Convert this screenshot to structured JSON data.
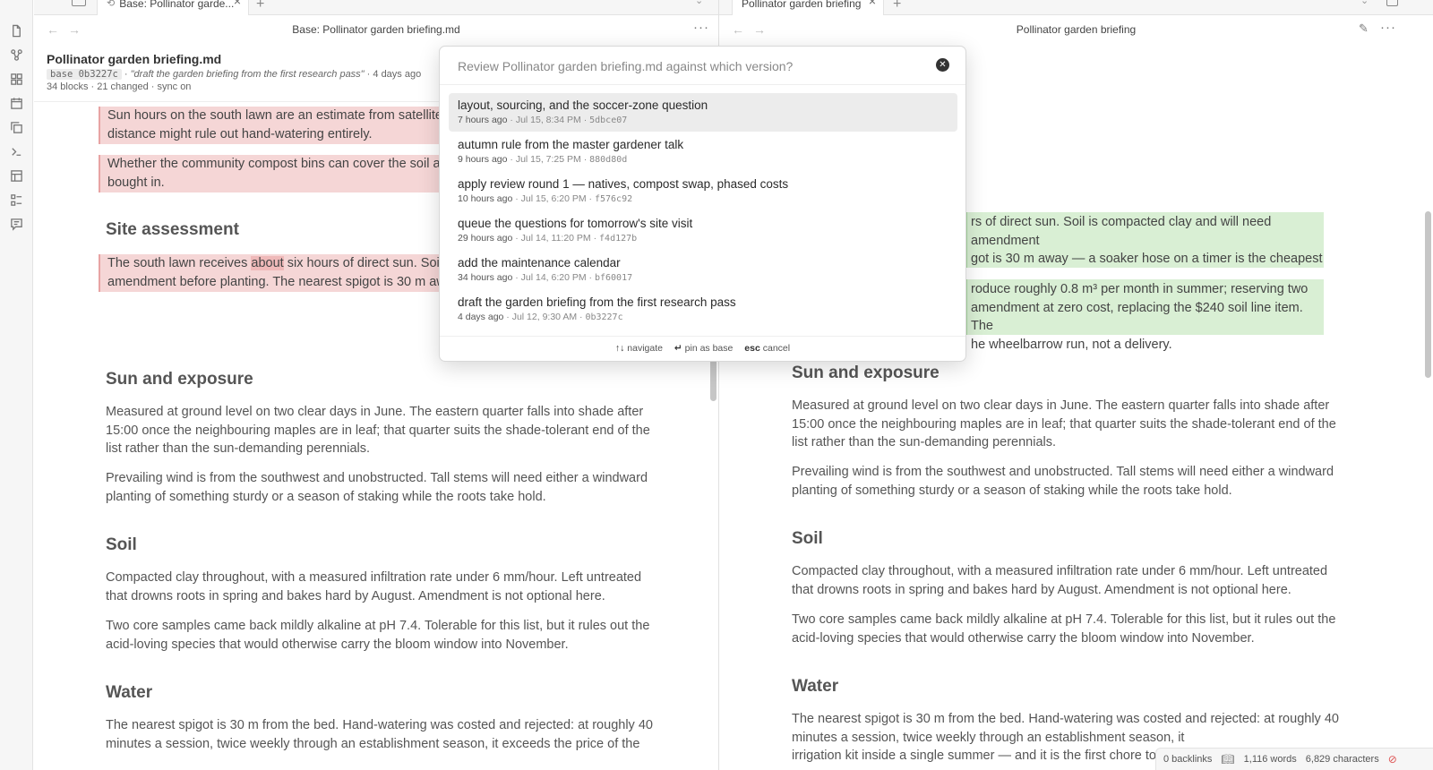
{
  "tabs": {
    "left_tab_label": "Base: Pollinator garde...",
    "right_tab_label": "Pollinator garden briefing"
  },
  "left_header": {
    "title": "Base: Pollinator garden briefing.md",
    "file_name": "Pollinator garden briefing.md",
    "base_label": "base 0b3227c",
    "commit_message": "\"draft the garden briefing from the first research pass\"",
    "age": "4 days ago",
    "stats": "34 blocks · 21 changed · sync on"
  },
  "right_header": {
    "title": "Pollinator garden briefing"
  },
  "left_doc": {
    "p1": "Sun hours on the south lawn are an estimate from satellite im",
    "p1b": "distance might rule out hand-watering entirely.",
    "p2": "Whether the community compost bins can cover the soil ame",
    "p2b": "bought in.",
    "h_site": "Site assessment",
    "p3a_pre": "The south lawn receives ",
    "p3a_word": "about",
    "p3a_post": " six hours of direct sun. Soil is",
    "p3b": "amendment before planting. The nearest spigot is 30 m away",
    "h_sun": "Sun and exposure",
    "sun1a": "Measured at ground level on two clear days in June. The eastern quarter falls into shade after",
    "sun1b": "15:00 once the neighbouring maples are in leaf; that quarter suits the shade-tolerant end of the",
    "sun1c": "list rather than the sun-demanding perennials.",
    "sun2a": "Prevailing wind is from the southwest and unobstructed. Tall stems will need either a windward",
    "sun2b": "planting of something sturdy or a season of staking while the roots take hold.",
    "h_soil": "Soil",
    "soil1a": "Compacted clay throughout, with a measured infiltration rate under 6 mm/hour. Left untreated",
    "soil1b": "that drowns roots in spring and bakes hard by August. Amendment is not optional here.",
    "soil2a": "Two core samples came back mildly alkaline at pH 7.4. Tolerable for this list, but it rules out the",
    "soil2b": "acid-loving species that would otherwise carry the bloom window into November.",
    "h_water": "Water",
    "water1a": "The nearest spigot is 30 m from the bed. Hand-watering was costed and rejected: at roughly 40",
    "water1b": "minutes a session, twice weekly through an establishment season, it exceeds the price of the"
  },
  "right_doc": {
    "g1a": "rs of direct sun. Soil is compacted clay and will need amendment",
    "g1b": "got is 30 m away — a soaker hose on a timer is the cheapest",
    "g2a": "roduce roughly 0.8 m³ per month in summer; reserving two",
    "g2b": "amendment at zero cost, replacing the $240 soil line item. The",
    "g2c": "he wheelbarrow run, not a delivery.",
    "h_sun": "Sun and exposure",
    "sun1a": "Measured at ground level on two clear days in June. The eastern quarter falls into shade after",
    "sun1b": "15:00 once the neighbouring maples are in leaf; that quarter suits the shade-tolerant end of the",
    "sun1c": "list rather than the sun-demanding perennials.",
    "sun2a": "Prevailing wind is from the southwest and unobstructed. Tall stems will need either a windward",
    "sun2b": "planting of something sturdy or a season of staking while the roots take hold.",
    "h_soil": "Soil",
    "soil1a": "Compacted clay throughout, with a measured infiltration rate under 6 mm/hour. Left untreated",
    "soil1b": "that drowns roots in spring and bakes hard by August. Amendment is not optional here.",
    "soil2a": "Two core samples came back mildly alkaline at pH 7.4. Tolerable for this list, but it rules out the",
    "soil2b": "acid-loving species that would otherwise carry the bloom window into November.",
    "h_water": "Water",
    "water1a": "The nearest spigot is 30 m from the bed. Hand-watering was costed and rejected: at roughly 40",
    "water1b": "minutes a session, twice weekly through an establishment season, it",
    "water1c": "irrigation kit inside a single summer — and it is the first chore to go"
  },
  "modal": {
    "prompt": "Review Pollinator garden briefing.md against which version?",
    "items": [
      {
        "title": "layout, sourcing, and the soccer-zone question",
        "ago": "7 hours ago",
        "when": "Jul 15, 8:34 PM",
        "hash": "5dbce07"
      },
      {
        "title": "autumn rule from the master gardener talk",
        "ago": "9 hours ago",
        "when": "Jul 15, 7:25 PM",
        "hash": "880d80d"
      },
      {
        "title": "apply review round 1 — natives, compost swap, phased costs",
        "ago": "10 hours ago",
        "when": "Jul 15, 6:20 PM",
        "hash": "f576c92"
      },
      {
        "title": "queue the questions for tomorrow's site visit",
        "ago": "29 hours ago",
        "when": "Jul 14, 11:20 PM",
        "hash": "f4d127b"
      },
      {
        "title": "add the maintenance calendar",
        "ago": "34 hours ago",
        "when": "Jul 14, 6:20 PM",
        "hash": "bf60017"
      },
      {
        "title": "draft the garden briefing from the first research pass",
        "ago": "4 days ago",
        "when": "Jul 12, 9:30 AM",
        "hash": "0b3227c"
      }
    ],
    "hint_nav_key": "↑↓",
    "hint_nav": "navigate",
    "hint_pin_key": "↵",
    "hint_pin": "pin as base",
    "hint_esc_key": "esc",
    "hint_esc": "cancel"
  },
  "status": {
    "backlinks": "0 backlinks",
    "words": "1,116 words",
    "chars": "6,829 characters"
  },
  "colors": {
    "removed_bg": "#f5d6d6",
    "added_bg": "#d9efd4",
    "selected_row": "#ececec"
  }
}
